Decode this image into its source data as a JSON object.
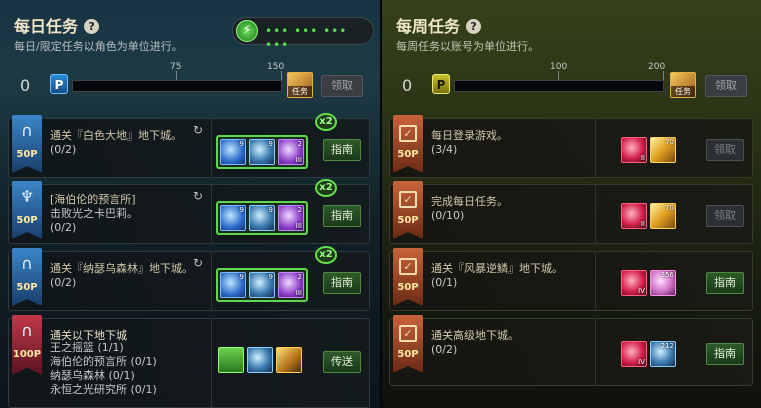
{
  "daily": {
    "title": "每日任务",
    "help": "?",
    "subtitle": "每日/限定任务以角色为单位进行。",
    "points": "0",
    "point_badge": "P",
    "tick1": "75",
    "tick2": "150",
    "reward_label": "任务",
    "claim_label": "领取",
    "battery_icon": "⚡",
    "battery_dots": "••• ••• ••• •••",
    "rows": [
      {
        "points": "50P",
        "title": "通关『白色大地』地下城。",
        "progress": "(0/2)",
        "refresh": "↻",
        "multiplier": "x2",
        "button": "指南",
        "items": [
          {
            "qty": "9"
          },
          {
            "qty": "9"
          },
          {
            "qty": "2",
            "lv": "III"
          }
        ]
      },
      {
        "points": "50P",
        "title": "[海伯伦的预言所]",
        "subtitle": "击败光之卡巴莉。",
        "progress": "(0/2)",
        "refresh": "↻",
        "multiplier": "x2",
        "button": "指南",
        "items": [
          {
            "qty": "9"
          },
          {
            "qty": "9"
          },
          {
            "qty": "2",
            "lv": "III"
          }
        ]
      },
      {
        "points": "50P",
        "title": "通关『纳瑟乌森林』地下城。",
        "progress": "(0/2)",
        "refresh": "↻",
        "multiplier": "x2",
        "button": "指南",
        "items": [
          {
            "qty": "9"
          },
          {
            "qty": "9"
          },
          {
            "qty": "2",
            "lv": "III"
          }
        ]
      },
      {
        "points": "100P",
        "title": "通关以下地下城",
        "subs": [
          "王之摇篮 (1/1)",
          "海伯伦的预言所 (0/1)",
          "纳瑟乌森林 (0/1)",
          "永恒之光研究所 (0/1)"
        ],
        "button": "传送"
      }
    ]
  },
  "weekly": {
    "title": "每周任务",
    "help": "?",
    "subtitle": "每周任务以账号为单位进行。",
    "points": "0",
    "point_badge": "P",
    "tick1": "100",
    "tick2": "200",
    "reward_label": "任务",
    "claim_label": "领取",
    "rows": [
      {
        "points": "50P",
        "title": "每日登录游戏。",
        "progress": "(3/4)",
        "button": "领取",
        "items": [
          {
            "lv": "II"
          },
          {
            "qty": "70"
          }
        ]
      },
      {
        "points": "50P",
        "title": "完成每日任务。",
        "progress": "(0/10)",
        "button": "领取",
        "items": [
          {
            "lv": "II"
          },
          {
            "qty": "70"
          }
        ]
      },
      {
        "points": "50P",
        "title": "通关『风暴逆鳞』地下城。",
        "progress": "(0/1)",
        "button": "指南",
        "items": [
          {
            "lv": "IV"
          },
          {
            "qty": "356"
          }
        ]
      },
      {
        "points": "50P",
        "title": "通关高级地下城。",
        "progress": "(0/2)",
        "button": "指南",
        "items": [
          {
            "lv": "IV"
          },
          {
            "qty": "212"
          }
        ]
      }
    ]
  },
  "colors": {
    "accent_green": "#5ed84a",
    "daily_bg": "#183444",
    "weekly_bg": "#36411a"
  },
  "icons": [
    "help-icon",
    "battery-icon",
    "refresh-icon",
    "check-calendar-icon",
    "portal-icon",
    "crystal-icon"
  ]
}
